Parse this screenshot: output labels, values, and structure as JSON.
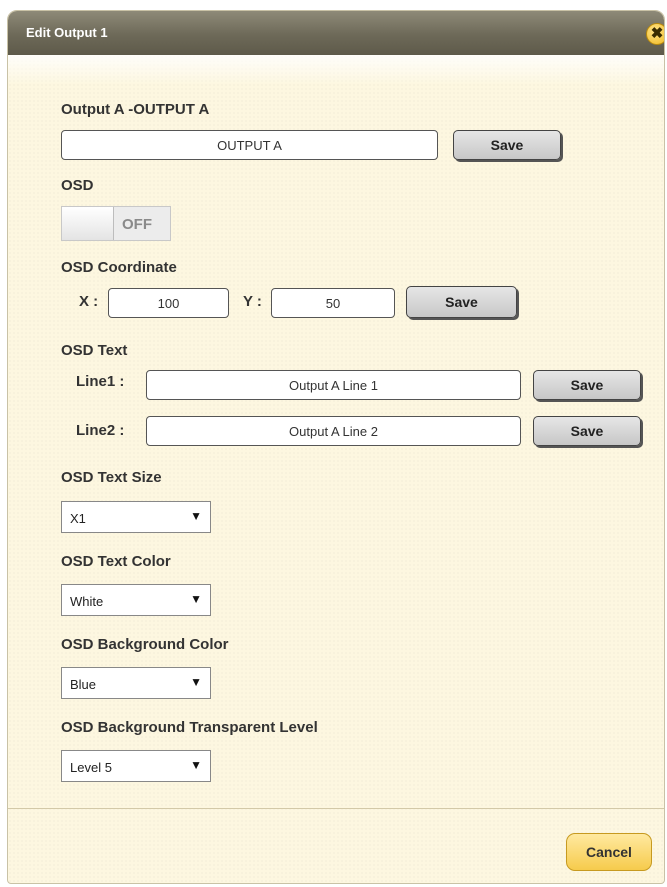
{
  "dialog": {
    "title": "Edit Output 1",
    "close_symbol": "✖",
    "close_icon": "close-icon"
  },
  "output_name": {
    "label": "Output A -OUTPUT A",
    "value": "OUTPUT A",
    "save_label": "Save"
  },
  "osd": {
    "label": "OSD",
    "toggle_state": "OFF"
  },
  "osd_coordinate": {
    "label": "OSD Coordinate",
    "x_label": "X :",
    "x_value": "100",
    "y_label": "Y :",
    "y_value": "50",
    "save_label": "Save"
  },
  "osd_text": {
    "label": "OSD Text",
    "line1_label": "Line1 :",
    "line1_value": "Output A Line 1",
    "line1_save": "Save",
    "line2_label": "Line2 :",
    "line2_value": "Output A Line 2",
    "line2_save": "Save"
  },
  "osd_text_size": {
    "label": "OSD Text Size",
    "selected": "X1"
  },
  "osd_text_color": {
    "label": "OSD Text Color",
    "selected": "White"
  },
  "osd_bg_color": {
    "label": "OSD Background Color",
    "selected": "Blue"
  },
  "osd_bg_transparent": {
    "label": "OSD Background Transparent Level",
    "selected": "Level 5"
  },
  "dropdown_arrow": "▼",
  "footer": {
    "cancel_label": "Cancel"
  },
  "colors": {
    "title_bar": "#6d6958",
    "dialog_bg": "#fdf7e0",
    "accent_button": "#f6cb4c"
  }
}
